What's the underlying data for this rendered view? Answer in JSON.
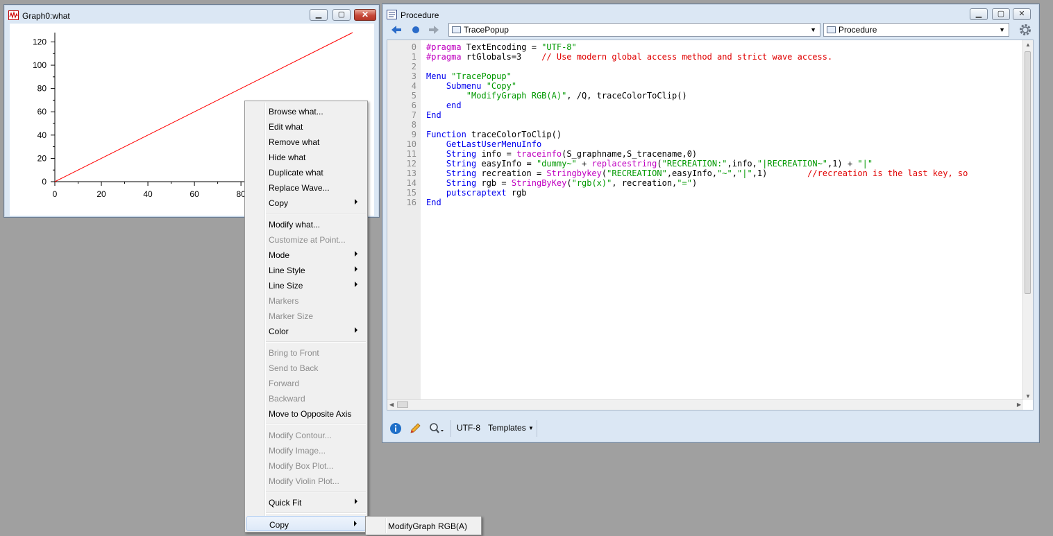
{
  "graph_window": {
    "title": "Graph0:what",
    "icon": "graph-icon",
    "chart_data": {
      "type": "line",
      "series": [
        {
          "x": [
            0,
            128
          ],
          "y": [
            0,
            128
          ],
          "color": "#ff0000"
        }
      ],
      "x_ticks": [
        "0",
        "20",
        "40",
        "60",
        "80"
      ],
      "y_ticks": [
        "0",
        "20",
        "40",
        "60",
        "80",
        "100",
        "120"
      ],
      "xlim": [
        0,
        128
      ],
      "ylim": [
        0,
        128
      ],
      "grid": false
    }
  },
  "procedure_window": {
    "title": "Procedure",
    "icon": "procedure-icon",
    "toolbar": {
      "back_icon": "arrow-left-icon",
      "home_icon": "dot-icon",
      "forward_icon": "arrow-right-icon",
      "menu_dropdown": "TracePopup",
      "type_dropdown": "Procedure",
      "settings_icon": "gear-icon"
    },
    "line_numbers": [
      "0",
      "1",
      "2",
      "3",
      "4",
      "5",
      "6",
      "7",
      "8",
      "9",
      "10",
      "11",
      "12",
      "13",
      "14",
      "15",
      "16"
    ],
    "code_lines": [
      [
        {
          "t": "#pragma",
          "c": "pr"
        },
        {
          "t": " TextEncoding = ",
          "c": "tx"
        },
        {
          "t": "\"UTF-8\"",
          "c": "st"
        }
      ],
      [
        {
          "t": "#pragma",
          "c": "pr"
        },
        {
          "t": " rtGlobals=3    ",
          "c": "tx"
        },
        {
          "t": "// Use modern global access method and strict wave access.",
          "c": "cm"
        }
      ],
      [],
      [
        {
          "t": "Menu ",
          "c": "kw"
        },
        {
          "t": "\"TracePopup\"",
          "c": "st"
        }
      ],
      [
        {
          "t": "    Submenu ",
          "c": "kw"
        },
        {
          "t": "\"Copy\"",
          "c": "st"
        }
      ],
      [
        {
          "t": "        \"ModifyGraph RGB(A)\"",
          "c": "st"
        },
        {
          "t": ", /Q, traceColorToClip()",
          "c": "tx"
        }
      ],
      [
        {
          "t": "    end",
          "c": "kw"
        }
      ],
      [
        {
          "t": "End",
          "c": "kw"
        }
      ],
      [],
      [
        {
          "t": "Function ",
          "c": "kw"
        },
        {
          "t": "traceColorToClip()",
          "c": "tx"
        }
      ],
      [
        {
          "t": "    GetLastUserMenuInfo",
          "c": "kw"
        }
      ],
      [
        {
          "t": "    String ",
          "c": "kw"
        },
        {
          "t": "info = ",
          "c": "tx"
        },
        {
          "t": "traceinfo",
          "c": "fn"
        },
        {
          "t": "(S_graphname,S_tracename,0)",
          "c": "tx"
        }
      ],
      [
        {
          "t": "    String ",
          "c": "kw"
        },
        {
          "t": "easyInfo = ",
          "c": "tx"
        },
        {
          "t": "\"dummy~\"",
          "c": "st"
        },
        {
          "t": " + ",
          "c": "tx"
        },
        {
          "t": "replacestring",
          "c": "fn"
        },
        {
          "t": "(",
          "c": "tx"
        },
        {
          "t": "\"RECREATION:\"",
          "c": "st"
        },
        {
          "t": ",info,",
          "c": "tx"
        },
        {
          "t": "\"|RECREATION~\"",
          "c": "st"
        },
        {
          "t": ",1) + ",
          "c": "tx"
        },
        {
          "t": "\"|\"",
          "c": "st"
        }
      ],
      [
        {
          "t": "    String ",
          "c": "kw"
        },
        {
          "t": "recreation = ",
          "c": "tx"
        },
        {
          "t": "Stringbykey",
          "c": "fn"
        },
        {
          "t": "(",
          "c": "tx"
        },
        {
          "t": "\"RECREATION\"",
          "c": "st"
        },
        {
          "t": ",easyInfo,",
          "c": "tx"
        },
        {
          "t": "\"~\"",
          "c": "st"
        },
        {
          "t": ",",
          "c": "tx"
        },
        {
          "t": "\"|\"",
          "c": "st"
        },
        {
          "t": ",1)        ",
          "c": "tx"
        },
        {
          "t": "//recreation is the last key, so",
          "c": "cm"
        }
      ],
      [
        {
          "t": "    String ",
          "c": "kw"
        },
        {
          "t": "rgb = ",
          "c": "tx"
        },
        {
          "t": "StringByKey",
          "c": "fn"
        },
        {
          "t": "(",
          "c": "tx"
        },
        {
          "t": "\"rgb(x)\"",
          "c": "st"
        },
        {
          "t": ", recreation,",
          "c": "tx"
        },
        {
          "t": "\"=\"",
          "c": "st"
        },
        {
          "t": ")",
          "c": "tx"
        }
      ],
      [
        {
          "t": "    putscraptext ",
          "c": "kw"
        },
        {
          "t": "rgb",
          "c": "tx"
        }
      ],
      [
        {
          "t": "End",
          "c": "kw"
        }
      ]
    ],
    "statusbar": {
      "info_icon": "info-icon",
      "edit_icon": "pencil-icon",
      "search_icon": "magnifier-icon",
      "encoding": "UTF-8",
      "templates": "Templates"
    }
  },
  "context_menu": {
    "items": [
      {
        "label": "Browse what...",
        "enabled": true,
        "submenu": false
      },
      {
        "label": "Edit what",
        "enabled": true,
        "submenu": false
      },
      {
        "label": "Remove what",
        "enabled": true,
        "submenu": false
      },
      {
        "label": "Hide what",
        "enabled": true,
        "submenu": false
      },
      {
        "label": "Duplicate what",
        "enabled": true,
        "submenu": false
      },
      {
        "label": "Replace Wave...",
        "enabled": true,
        "submenu": false
      },
      {
        "label": "Copy",
        "enabled": true,
        "submenu": true
      },
      {
        "sep": true
      },
      {
        "label": "Modify what...",
        "enabled": true,
        "submenu": false
      },
      {
        "label": "Customize at Point...",
        "enabled": false,
        "submenu": false
      },
      {
        "label": "Mode",
        "enabled": true,
        "submenu": true
      },
      {
        "label": "Line Style",
        "enabled": true,
        "submenu": true
      },
      {
        "label": "Line Size",
        "enabled": true,
        "submenu": true
      },
      {
        "label": "Markers",
        "enabled": false,
        "submenu": false
      },
      {
        "label": "Marker Size",
        "enabled": false,
        "submenu": false
      },
      {
        "label": "Color",
        "enabled": true,
        "submenu": true
      },
      {
        "sep": true
      },
      {
        "label": "Bring to Front",
        "enabled": false,
        "submenu": false
      },
      {
        "label": "Send to Back",
        "enabled": false,
        "submenu": false
      },
      {
        "label": "Forward",
        "enabled": false,
        "submenu": false
      },
      {
        "label": "Backward",
        "enabled": false,
        "submenu": false
      },
      {
        "label": "Move to Opposite Axis",
        "enabled": true,
        "submenu": false
      },
      {
        "sep": true
      },
      {
        "label": "Modify Contour...",
        "enabled": false,
        "submenu": false
      },
      {
        "label": "Modify Image...",
        "enabled": false,
        "submenu": false
      },
      {
        "label": "Modify Box Plot...",
        "enabled": false,
        "submenu": false
      },
      {
        "label": "Modify Violin Plot...",
        "enabled": false,
        "submenu": false
      },
      {
        "sep": true
      },
      {
        "label": "Quick Fit",
        "enabled": true,
        "submenu": true
      },
      {
        "sep": true
      },
      {
        "label": "Copy",
        "enabled": true,
        "submenu": true,
        "highlighted": true
      }
    ]
  },
  "sub_menu": {
    "items": [
      {
        "label": "ModifyGraph RGB(A)",
        "enabled": true
      }
    ]
  }
}
